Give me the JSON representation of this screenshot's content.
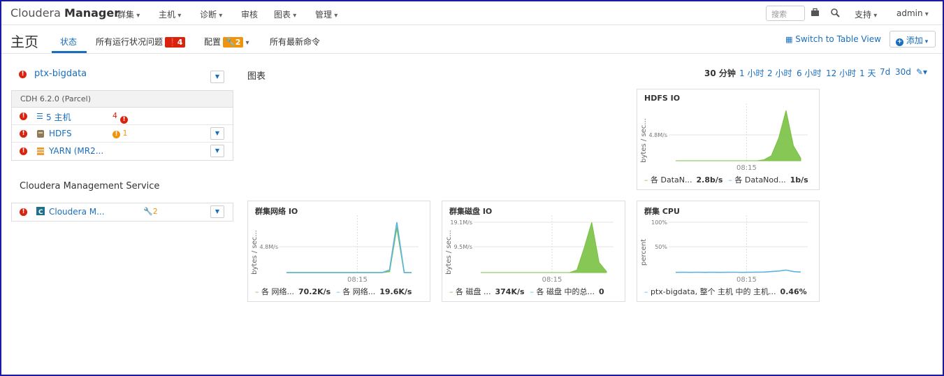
{
  "app": {
    "brand_light": "Cloudera ",
    "brand_bold": "Manager"
  },
  "nav": {
    "items": [
      "群集",
      "主机",
      "诊断",
      "审核",
      "图表",
      "管理"
    ],
    "search_placeholder": "搜索",
    "support": "支持",
    "user": "admin"
  },
  "subnav": {
    "title": "主页",
    "tab_status": "状态",
    "tab_issues": "所有运行状况问题",
    "issues_count": "4",
    "tab_config": "配置",
    "config_count": "2",
    "tab_commands": "所有最新命令",
    "switch_view": "Switch to Table View",
    "add": "添加"
  },
  "cluster": {
    "name": "ptx-bigdata",
    "version": "CDH 6.2.0 (Parcel)",
    "rows": [
      {
        "name": "5 主机",
        "alert": "4",
        "alert_type": "error"
      },
      {
        "name": "HDFS",
        "alert": "1",
        "alert_type": "warning"
      },
      {
        "name": "YARN (MR2...",
        "alert": "",
        "alert_type": ""
      }
    ]
  },
  "cms": {
    "title": "Cloudera Management Service",
    "row_name": "Cloudera M...",
    "row_alert": "2"
  },
  "charts": {
    "title": "图表",
    "ranges": [
      "30 分钟",
      "1 小时",
      "2 小时",
      "6 小时",
      "12 小时",
      "1 天",
      "7d",
      "30d"
    ],
    "current_range": "30 分钟"
  },
  "chart_data": [
    {
      "type": "area",
      "title": "HDFS IO",
      "ylabel": "bytes / sec...",
      "yticks": [
        "4.8M/s"
      ],
      "xticks": [
        "08:15"
      ],
      "legend": [
        {
          "name": "各 DataN...",
          "value": "2.8b/s",
          "color": "#7ac143"
        },
        {
          "name": "各 DataNod...",
          "value": "1b/s",
          "color": "#5bb3e0"
        }
      ],
      "series": [
        {
          "name": "各 DataN...",
          "values": [
            0,
            0,
            0,
            0,
            0,
            0,
            0,
            0,
            0,
            0,
            0,
            0,
            0.02,
            0.1,
            0.45,
            1.0,
            0.3,
            0.05
          ]
        }
      ]
    },
    {
      "type": "line",
      "title": "群集网络 IO",
      "ylabel": "bytes / sec...",
      "yticks": [
        "4.8M/s"
      ],
      "xticks": [
        "08:15"
      ],
      "legend": [
        {
          "name": "各 网络...",
          "value": "70.2K/s",
          "color": "#7ac143"
        },
        {
          "name": "各 网络...",
          "value": "19.6K/s",
          "color": "#5bb3e0"
        }
      ],
      "series": [
        {
          "name": "各 网络...",
          "values": [
            0,
            0,
            0,
            0,
            0,
            0,
            0,
            0,
            0,
            0,
            0,
            0,
            0,
            0,
            0.02,
            0.9,
            0,
            0
          ]
        },
        {
          "name": "各 网络...",
          "values": [
            0,
            0,
            0,
            0,
            0,
            0,
            0,
            0,
            0,
            0,
            0,
            0,
            0,
            0,
            0.05,
            1.0,
            0,
            0
          ]
        }
      ]
    },
    {
      "type": "area",
      "title": "群集磁盘 IO",
      "ylabel": "bytes / sec...",
      "yticks": [
        "19.1M/s",
        "9.5M/s"
      ],
      "xticks": [
        "08:15"
      ],
      "legend": [
        {
          "name": "各 磁盘 ...",
          "value": "374K/s",
          "color": "#7ac143"
        },
        {
          "name": "各 磁盘 中的总...",
          "value": "0",
          "color": "#5bb3e0"
        }
      ],
      "series": [
        {
          "name": "各 磁盘 ...",
          "values": [
            0,
            0,
            0,
            0,
            0,
            0,
            0,
            0,
            0,
            0,
            0,
            0,
            0,
            0.05,
            0.5,
            1.0,
            0.2,
            0.02
          ]
        }
      ]
    },
    {
      "type": "line",
      "title": "群集 CPU",
      "ylabel": "percent",
      "yticks": [
        "100%",
        "50%"
      ],
      "xticks": [
        "08:15"
      ],
      "legend": [
        {
          "name": "ptx-bigdata, 整个 主机 中的 主机...",
          "value": "0.46%",
          "color": "#5bb3e0"
        }
      ],
      "series": [
        {
          "name": "ptx-bigdata, 整个 主机 中的 主机...",
          "values": [
            0.005,
            0.006,
            0.005,
            0.007,
            0.005,
            0.006,
            0.005,
            0.006,
            0.007,
            0.005,
            0.006,
            0.008,
            0.01,
            0.02,
            0.03,
            0.05,
            0.02,
            0.01
          ]
        }
      ]
    }
  ]
}
